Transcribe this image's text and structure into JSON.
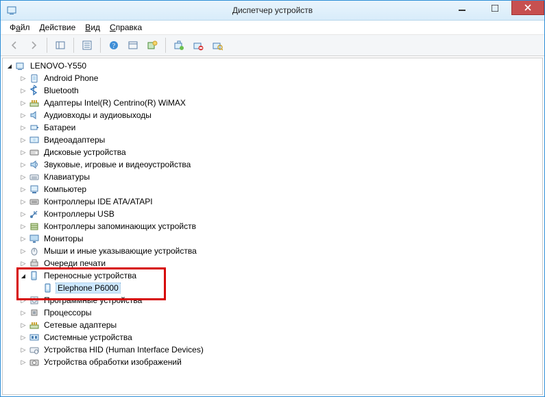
{
  "title": "Диспетчер устройств",
  "menu": {
    "file": {
      "pre": "Ф",
      "ul": "а",
      "post": "йл"
    },
    "action": {
      "pre": "",
      "ul": "Д",
      "post": "ействие"
    },
    "view": {
      "pre": "",
      "ul": "В",
      "post": "ид"
    },
    "help": {
      "pre": "",
      "ul": "С",
      "post": "правка"
    }
  },
  "root": "LENOVO-Y550",
  "categories": [
    {
      "icon": "android",
      "label": "Android Phone"
    },
    {
      "icon": "bt",
      "label": "Bluetooth"
    },
    {
      "icon": "net",
      "label": "Адаптеры Intel(R) Centrino(R) WiMAX"
    },
    {
      "icon": "audio",
      "label": "Аудиовходы и аудиовыходы"
    },
    {
      "icon": "battery",
      "label": "Батареи"
    },
    {
      "icon": "video",
      "label": "Видеоадаптеры"
    },
    {
      "icon": "disk",
      "label": "Дисковые устройства"
    },
    {
      "icon": "sound",
      "label": "Звуковые, игровые и видеоустройства"
    },
    {
      "icon": "kbd",
      "label": "Клавиатуры"
    },
    {
      "icon": "pc",
      "label": "Компьютер"
    },
    {
      "icon": "ide",
      "label": "Контроллеры IDE ATA/ATAPI"
    },
    {
      "icon": "usb",
      "label": "Контроллеры USB"
    },
    {
      "icon": "storage",
      "label": "Контроллеры запоминающих устройств"
    },
    {
      "icon": "monitor",
      "label": "Мониторы"
    },
    {
      "icon": "mouse",
      "label": "Мыши и иные указывающие устройства"
    },
    {
      "icon": "printq",
      "label": "Очереди печати"
    },
    {
      "icon": "portable",
      "label": "Переносные устройства",
      "expanded": true,
      "children": [
        {
          "icon": "portable",
          "label": "Elephone P6000",
          "selected": true
        }
      ]
    },
    {
      "icon": "soft",
      "label": "Программные устройства"
    },
    {
      "icon": "cpu",
      "label": "Процессоры"
    },
    {
      "icon": "net",
      "label": "Сетевые адаптеры"
    },
    {
      "icon": "sys",
      "label": "Системные устройства"
    },
    {
      "icon": "hid",
      "label": "Устройства HID (Human Interface Devices)"
    },
    {
      "icon": "imaging",
      "label": "Устройства обработки изображений"
    }
  ]
}
